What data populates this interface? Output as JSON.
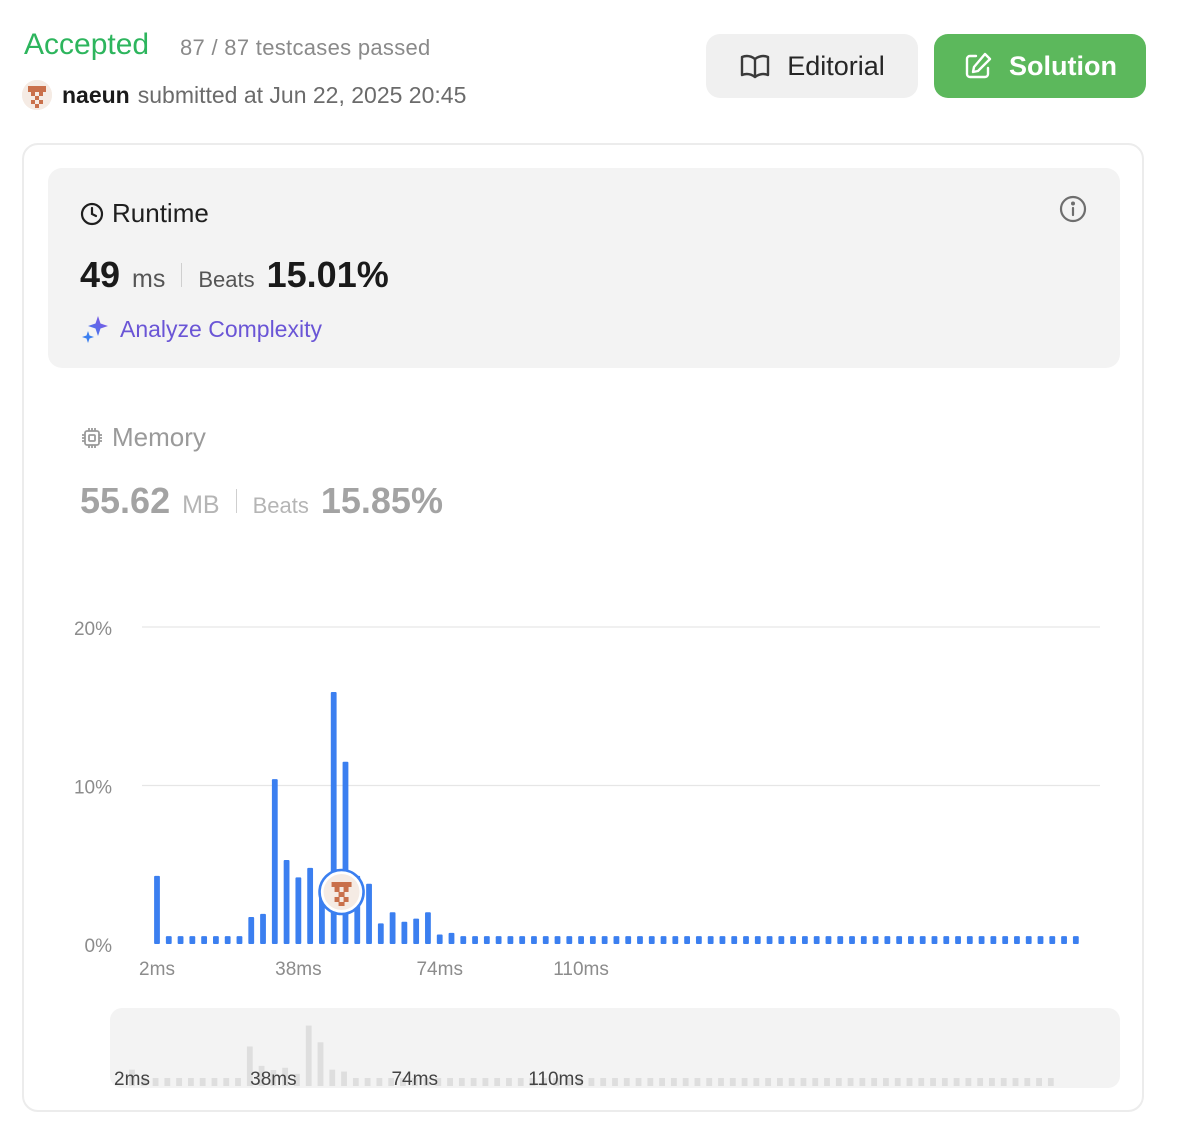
{
  "header": {
    "status": "Accepted",
    "testcases": "87 / 87 testcases passed",
    "username": "naeun",
    "submitted_text": "submitted at Jun 22, 2025 20:45",
    "editorial_label": "Editorial",
    "solution_label": "Solution"
  },
  "colors": {
    "accepted": "#2db55d",
    "solution_button": "#5cb85c",
    "bar": "#3b7ff0",
    "analyze": "#6a55d6",
    "avatar": "#c9704b"
  },
  "runtime": {
    "title": "Runtime",
    "value": "49",
    "unit": "ms",
    "beats_label": "Beats",
    "beats_value": "15.01%",
    "analyze_label": "Analyze Complexity"
  },
  "memory": {
    "title": "Memory",
    "value": "55.62",
    "unit": "MB",
    "beats_label": "Beats",
    "beats_value": "15.85%"
  },
  "icons": [
    "avatar-icon",
    "book-icon",
    "edit-icon",
    "clock-icon",
    "info-icon",
    "sparkle-icon",
    "chip-icon"
  ],
  "chart_data": {
    "type": "bar",
    "x_unit": "ms",
    "x_start": 2,
    "x_step": 3,
    "y_unit": "%",
    "ylim": [
      0,
      20
    ],
    "y_ticks": [
      "0%",
      "10%",
      "20%"
    ],
    "x_ticks": [
      "2ms",
      "38ms",
      "74ms",
      "110ms"
    ],
    "grid": true,
    "values": [
      4.3,
      0.5,
      0.5,
      0.5,
      0.5,
      0.5,
      0.5,
      0.5,
      1.7,
      1.9,
      10.4,
      5.3,
      4.2,
      4.8,
      3.2,
      15.9,
      11.5,
      4.3,
      3.8,
      1.3,
      2.0,
      1.4,
      1.6,
      2.0,
      0.6,
      0.7,
      0.5,
      0.5,
      0.5,
      0.5,
      0.5,
      0.5,
      0.5,
      0.5,
      0.5,
      0.5,
      0.5,
      0.5,
      0.5,
      0.5,
      0.5,
      0.5,
      0.5,
      0.5,
      0.5,
      0.5,
      0.5,
      0.5,
      0.5,
      0.5,
      0.5,
      0.5,
      0.5,
      0.5,
      0.5,
      0.5,
      0.5,
      0.5,
      0.5,
      0.5,
      0.5,
      0.5,
      0.5,
      0.5,
      0.5,
      0.5,
      0.5,
      0.5,
      0.5,
      0.5,
      0.5,
      0.5,
      0.5,
      0.5,
      0.5,
      0.5,
      0.5,
      0.5,
      0.5
    ],
    "highlight_x": 49
  },
  "overview": {
    "x_ticks": [
      "2ms",
      "38ms",
      "74ms",
      "110ms"
    ]
  }
}
